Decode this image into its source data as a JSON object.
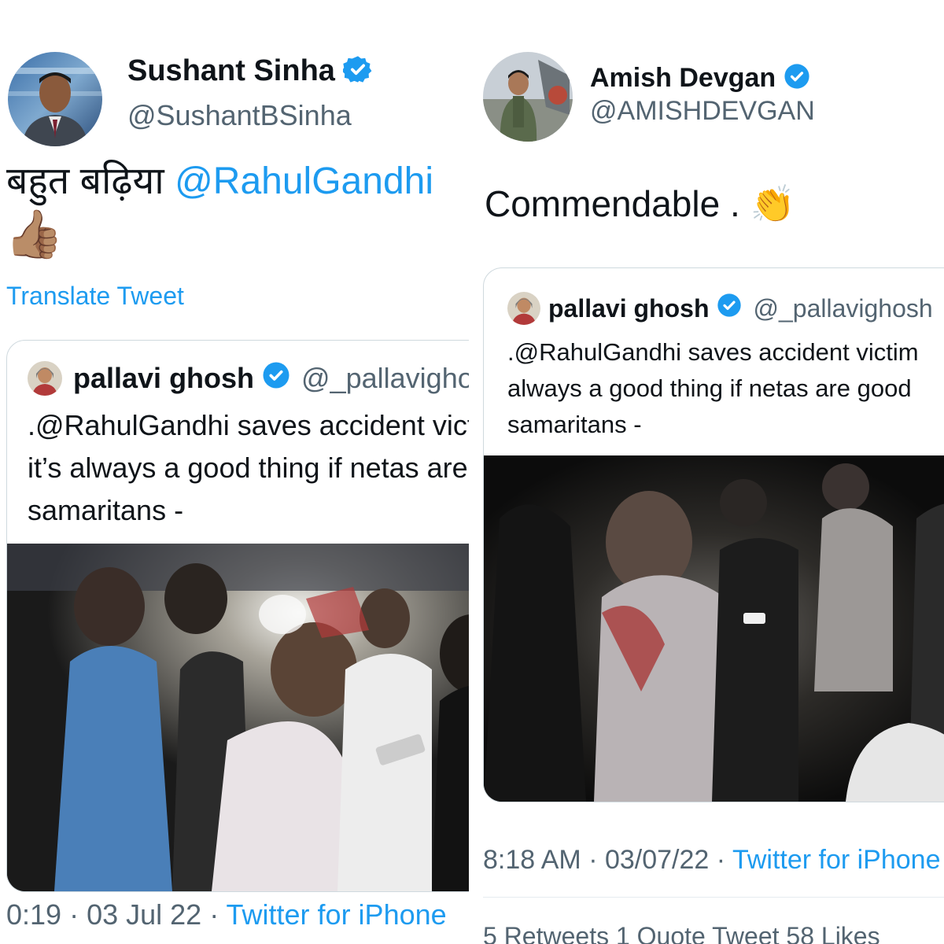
{
  "left": {
    "author": {
      "name": "Sushant Sinha",
      "handle": "@SushantBSinha"
    },
    "tweet": {
      "text": "बहुत बढ़िया ",
      "mention": "@RahulGandhi",
      "emoji": "👍🏽"
    },
    "translate_label": "Translate Tweet",
    "quote": {
      "name": "pallavi ghosh",
      "handle": "@_pallavighosh",
      "lines": [
        ".@RahulGandhi saves accident victim . And it’s always a good thing if netas are good",
        "it’s always a good thing if netas are good",
        "samaritans -"
      ]
    },
    "meta": {
      "time": "0:19",
      "sep": " · ",
      "date": "03 Jul 22",
      "sep2": " · ",
      "source": "Twitter for iPhone"
    }
  },
  "right": {
    "author": {
      "name": "Amish Devgan",
      "handle": "@AMISHDEVGAN"
    },
    "tweet": {
      "text": "Commendable . ",
      "emoji": "👏"
    },
    "quote": {
      "name": "pallavi ghosh",
      "handle": "@_pallavighosh",
      "lines": [
        ".@RahulGandhi saves accident victim",
        "always a good thing if netas are good",
        "samaritans -"
      ]
    },
    "meta": {
      "time": "8:18 AM",
      "sep": " · ",
      "date": "03/07/22",
      "sep2": " · ",
      "source": "Twitter for iPhone"
    },
    "stats": "5 Retweets  1 Quote Tweet  58 Likes"
  },
  "colors": {
    "link": "#1d9bf0",
    "verified": "#1d9bf0",
    "secondary": "#536471",
    "border": "#cfd9de"
  }
}
